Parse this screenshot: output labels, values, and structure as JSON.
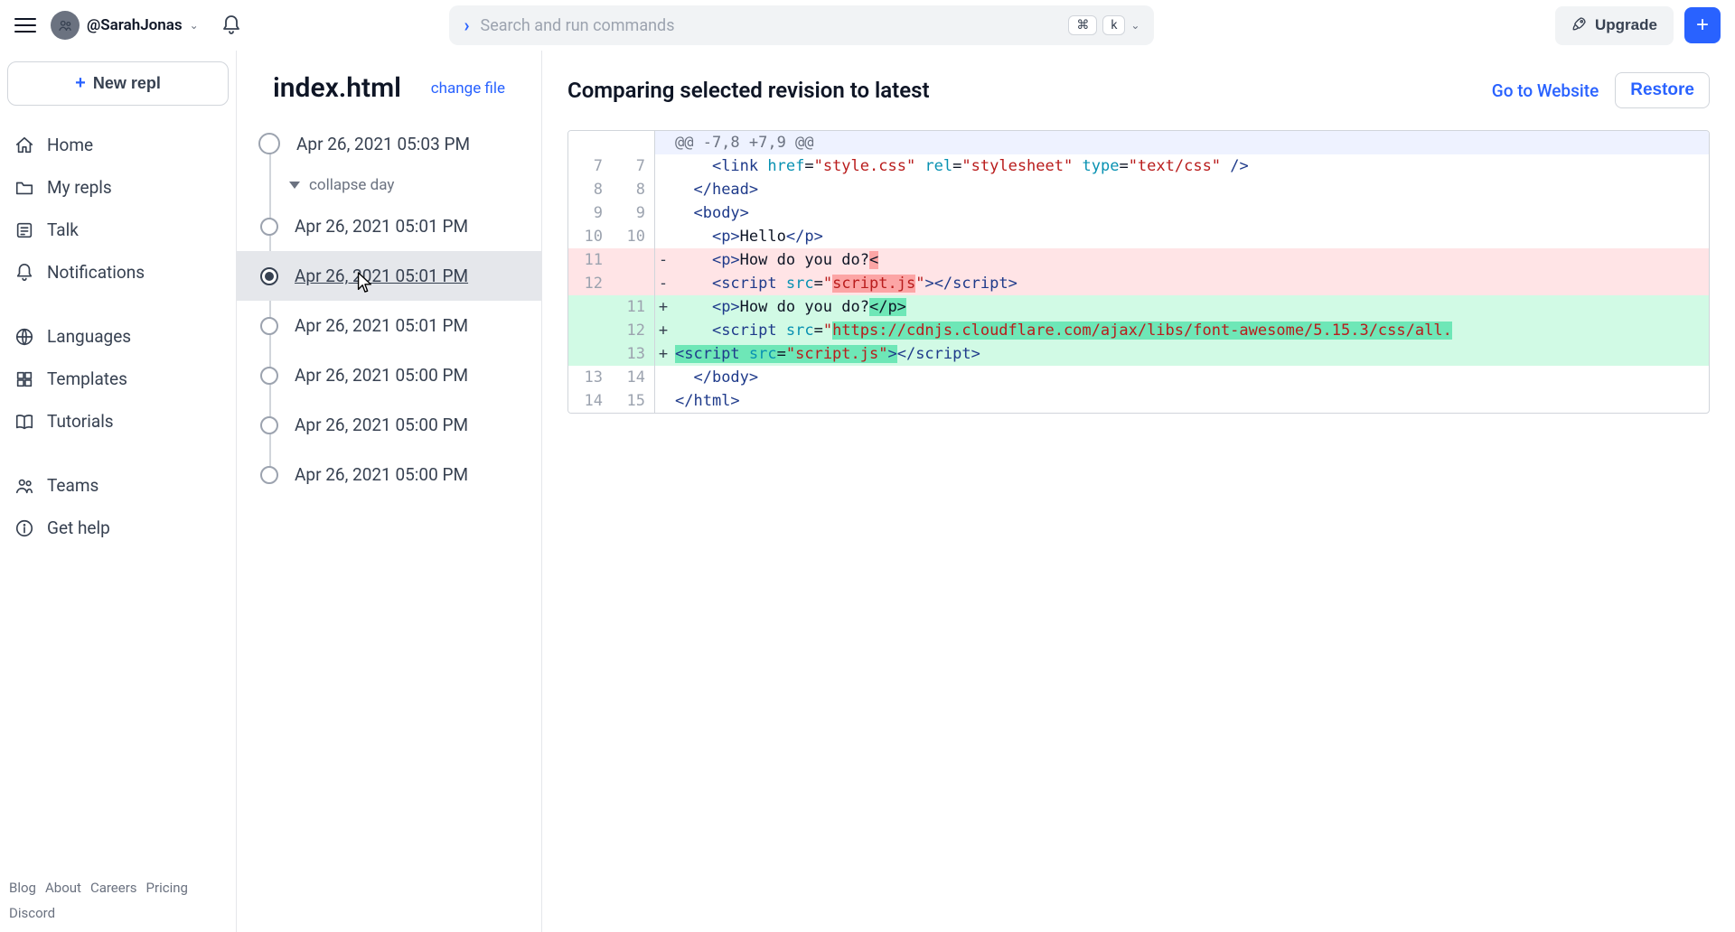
{
  "header": {
    "username": "@SarahJonas",
    "search_placeholder": "Search and run commands",
    "kbd1": "⌘",
    "kbd2": "k",
    "upgrade_label": "Upgrade"
  },
  "sidebar": {
    "new_repl_label": "New repl",
    "items": [
      {
        "label": "Home",
        "icon": "home"
      },
      {
        "label": "My repls",
        "icon": "folder"
      },
      {
        "label": "Talk",
        "icon": "post"
      },
      {
        "label": "Notifications",
        "icon": "bell"
      }
    ],
    "items2": [
      {
        "label": "Languages",
        "icon": "globe"
      },
      {
        "label": "Templates",
        "icon": "grid"
      },
      {
        "label": "Tutorials",
        "icon": "book"
      }
    ],
    "items3": [
      {
        "label": "Teams",
        "icon": "people"
      },
      {
        "label": "Get help",
        "icon": "info"
      }
    ],
    "footer": [
      "Blog",
      "About",
      "Careers",
      "Pricing",
      "Discord"
    ]
  },
  "history": {
    "filename": "index.html",
    "change_file_label": "change file",
    "collapse_label": "collapse day",
    "revisions": [
      {
        "label": "Apr 26, 2021 05:03 PM",
        "big": true,
        "selected": false
      },
      {
        "label": "Apr 26, 2021 05:01 PM",
        "big": false,
        "selected": false
      },
      {
        "label": "Apr 26, 2021 05:01 PM",
        "big": false,
        "selected": true
      },
      {
        "label": "Apr 26, 2021 05:01 PM",
        "big": false,
        "selected": false
      },
      {
        "label": "Apr 26, 2021 05:00 PM",
        "big": false,
        "selected": false
      },
      {
        "label": "Apr 26, 2021 05:00 PM",
        "big": false,
        "selected": false
      },
      {
        "label": "Apr 26, 2021 05:00 PM",
        "big": false,
        "selected": false
      }
    ]
  },
  "diff": {
    "title": "Comparing selected revision to latest",
    "goto_label": "Go to Website",
    "restore_label": "Restore",
    "hunk": "@@ -7,8 +7,9 @@",
    "lines": [
      {
        "old": "7",
        "new": "7",
        "type": "ctx",
        "html": "    <span class='tag'>&lt;link</span> <span class='attr'>href</span>=<span class='str'>\"style.css\"</span> <span class='attr'>rel</span>=<span class='str'>\"stylesheet\"</span> <span class='attr'>type</span>=<span class='str'>\"text/css\"</span> <span class='tag'>/&gt;</span>"
      },
      {
        "old": "8",
        "new": "8",
        "type": "ctx",
        "html": "  <span class='tag'>&lt;/head&gt;</span>"
      },
      {
        "old": "9",
        "new": "9",
        "type": "ctx",
        "html": "  <span class='tag'>&lt;body&gt;</span>"
      },
      {
        "old": "10",
        "new": "10",
        "type": "ctx",
        "html": "    <span class='tag'>&lt;p&gt;</span>Hello<span class='tag'>&lt;/p&gt;</span>"
      },
      {
        "old": "11",
        "new": "",
        "type": "del",
        "html": "    <span class='tag'>&lt;p&gt;</span>How do you do?<span class='hl-del'>&lt;</span>"
      },
      {
        "old": "12",
        "new": "",
        "type": "del",
        "html": "    <span class='tag'>&lt;script</span> <span class='attr'>src</span>=<span class='str'>\"<span class='hl-del'>script.js</span>\"</span><span class='tag'>&gt;&lt;/script&gt;</span>"
      },
      {
        "old": "",
        "new": "11",
        "type": "add",
        "html": "    <span class='tag'>&lt;p&gt;</span>How do you do?<span class='hl-add'>&lt;/p&gt;</span>"
      },
      {
        "old": "",
        "new": "12",
        "type": "add",
        "html": "    <span class='tag'>&lt;script</span> <span class='attr'>src</span>=<span class='str'>\"<span class='hl-add'>https://cdnjs.cloudflare.com/ajax/libs/font-awesome/5.15.3/css/all.</span></span>"
      },
      {
        "old": "",
        "new": "13",
        "type": "add",
        "html": "<span class='hl-add'><span class='tag'>&lt;script</span> <span class='attr'>src</span>=<span class='str'>\"script.js\"</span><span class='tag'>&gt;</span></span><span class='tag'>&lt;/script&gt;</span>"
      },
      {
        "old": "13",
        "new": "14",
        "type": "ctx",
        "html": "  <span class='tag'>&lt;/body&gt;</span>"
      },
      {
        "old": "14",
        "new": "15",
        "type": "ctx",
        "html": "<span class='tag'>&lt;/html&gt;</span>"
      }
    ]
  }
}
